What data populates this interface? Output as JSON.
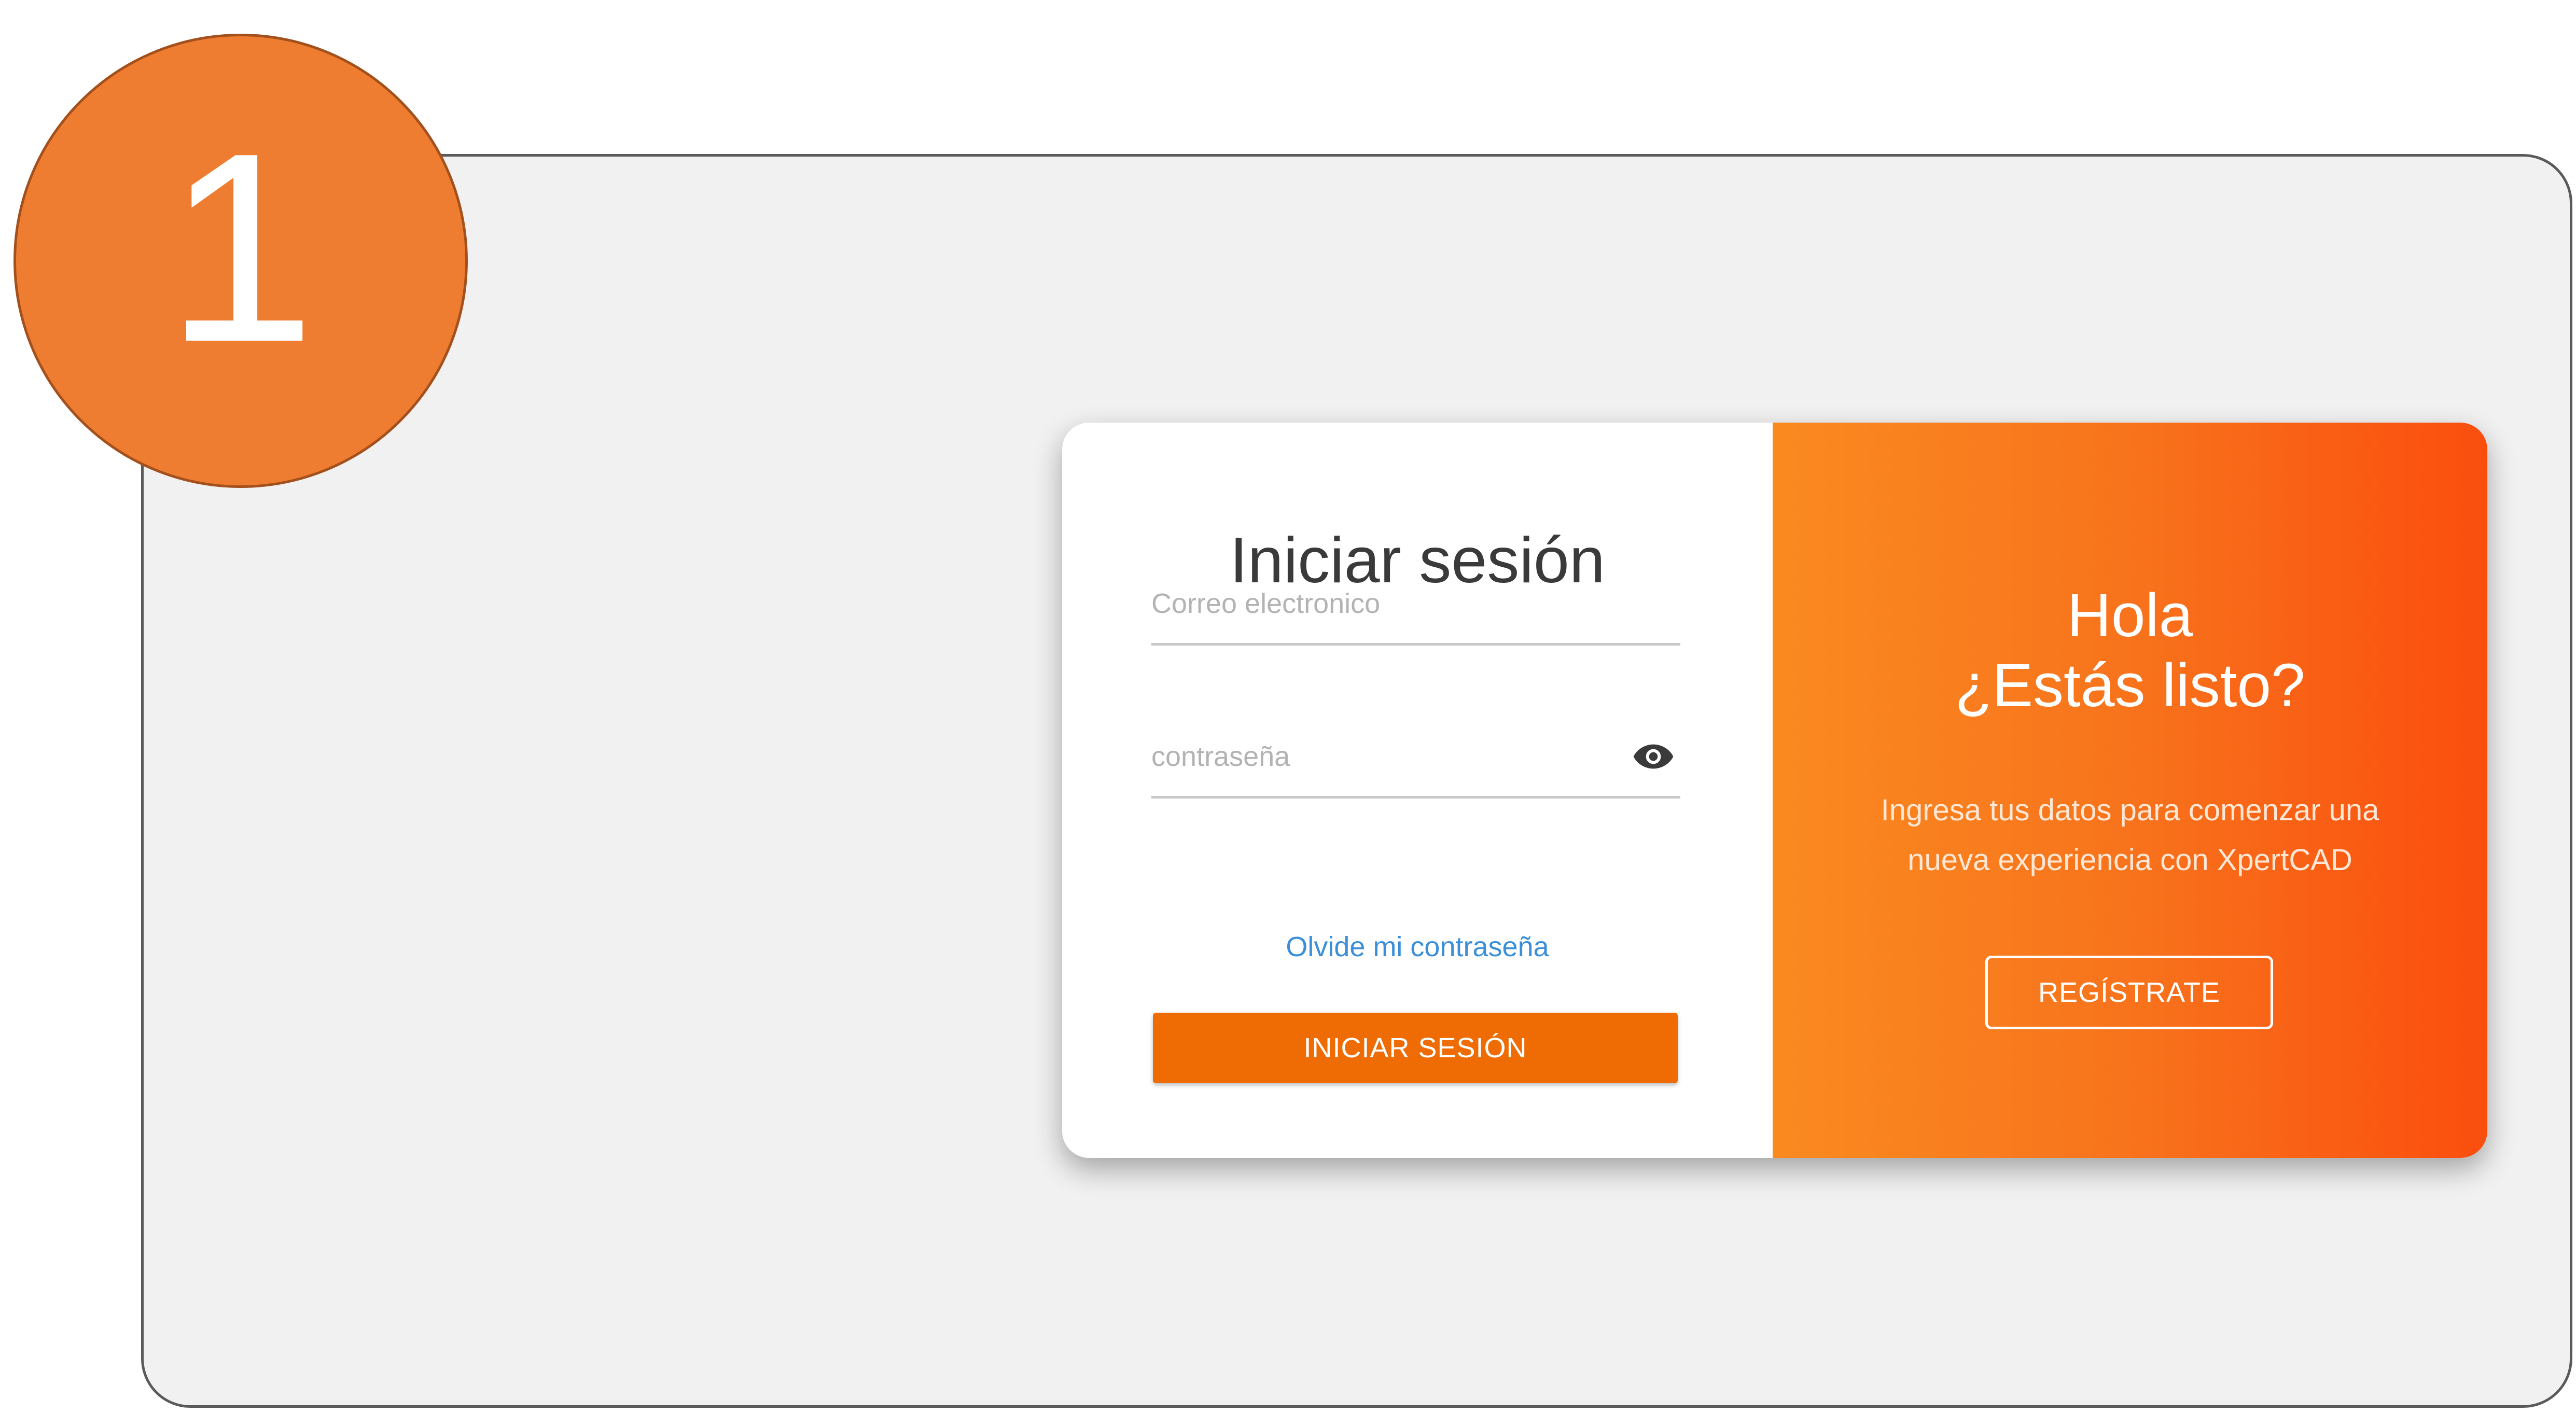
{
  "step": {
    "number": "1"
  },
  "login": {
    "title": "Iniciar sesión",
    "email_placeholder": "Correo electronico",
    "password_placeholder": "contraseña",
    "forgot_password": "Olvide mi contraseña",
    "submit_label": "INICIAR SESIÓN"
  },
  "welcome": {
    "title_line1": "Hola",
    "title_line2": "¿Estás listo?",
    "text_line1": "Ingresa tus datos para comenzar una",
    "text_line2": "nueva experiencia con XpertCAD",
    "register_label": "REGÍSTRATE"
  },
  "colors": {
    "badge": "#ee7d31",
    "button": "#ee6c03",
    "gradient_start": "#fa8a20",
    "gradient_end": "#fa4e0e",
    "link": "#3a8fd8"
  },
  "icons": {
    "password_toggle": "eye-icon"
  }
}
